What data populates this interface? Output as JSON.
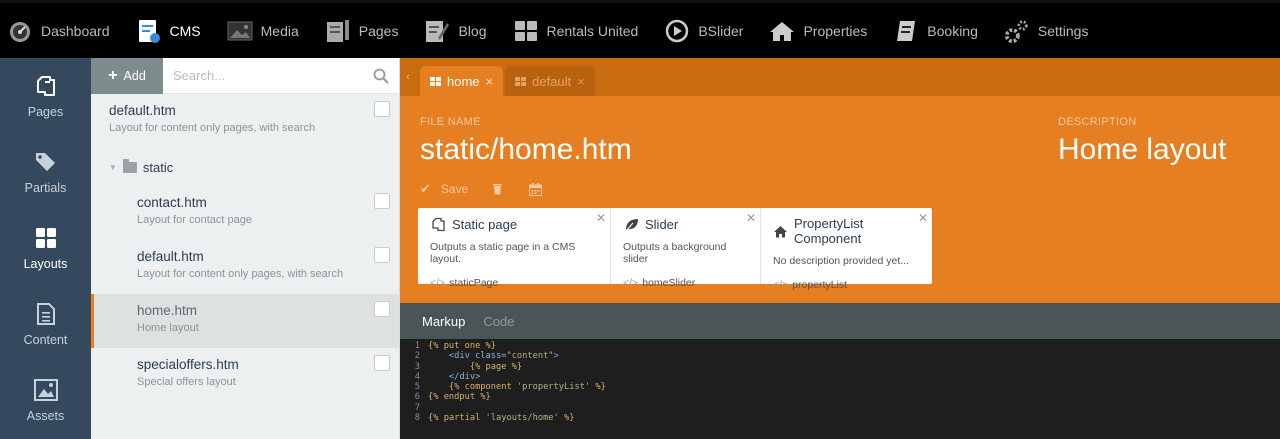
{
  "topnav": {
    "items": [
      {
        "label": "Dashboard",
        "icon": "dashboard-icon"
      },
      {
        "label": "CMS",
        "icon": "cms-icon"
      },
      {
        "label": "Media",
        "icon": "media-icon"
      },
      {
        "label": "Pages",
        "icon": "pages-icon"
      },
      {
        "label": "Blog",
        "icon": "blog-icon"
      },
      {
        "label": "Rentals United",
        "icon": "grid-icon"
      },
      {
        "label": "BSlider",
        "icon": "play-icon"
      },
      {
        "label": "Properties",
        "icon": "home-icon"
      },
      {
        "label": "Booking",
        "icon": "booking-icon"
      },
      {
        "label": "Settings",
        "icon": "gear-icon"
      }
    ],
    "active": "CMS"
  },
  "sidebar": {
    "items": [
      {
        "label": "Pages",
        "icon": "pages-copy-icon"
      },
      {
        "label": "Partials",
        "icon": "tags-icon"
      },
      {
        "label": "Layouts",
        "icon": "layouts-icon"
      },
      {
        "label": "Content",
        "icon": "file-icon"
      },
      {
        "label": "Assets",
        "icon": "image-icon"
      }
    ],
    "active": "Layouts"
  },
  "list": {
    "add_label": "Add",
    "search_placeholder": "Search...",
    "items": [
      {
        "title": "default.htm",
        "desc": "Layout for content only pages, with search"
      },
      {
        "title": "contact.htm",
        "desc": "Layout for contact page"
      },
      {
        "title": "default.htm",
        "desc": "Layout for content only pages, with search"
      },
      {
        "title": "home.htm",
        "desc": "Home layout"
      },
      {
        "title": "specialoffers.htm",
        "desc": "Special offers layout"
      }
    ],
    "folder": "static"
  },
  "tabs": [
    {
      "label": "home",
      "close": "×"
    },
    {
      "label": "default",
      "close": "×"
    }
  ],
  "form": {
    "file_name_label": "FILE NAME",
    "file_name": "static/home.htm",
    "description_label": "DESCRIPTION",
    "description": "Home layout",
    "save_label": "Save"
  },
  "components": [
    {
      "title": "Static page",
      "desc": "Outputs a static page in a CMS layout.",
      "alias": "staticPage",
      "icon": "static-page-icon"
    },
    {
      "title": "Slider",
      "desc": "Outputs a background slider",
      "alias": "homeSlider",
      "icon": "leaf-icon"
    },
    {
      "title": "PropertyList Component",
      "desc": "No description provided yet...",
      "alias": "propertyList",
      "icon": "home-icon"
    }
  ],
  "editor": {
    "tabs": [
      "Markup",
      "Code"
    ],
    "active_tab": "Markup",
    "lines": [
      "{% put one %}",
      "    <div class=\"content\">",
      "        {% page %}",
      "    </div>",
      "    {% component 'propertyList' %}",
      "{% endput %}",
      "",
      "{% partial 'layouts/home' %}"
    ]
  },
  "colors": {
    "accent": "#e67e22",
    "sidebar": "#34495e",
    "topbar": "#000000"
  }
}
